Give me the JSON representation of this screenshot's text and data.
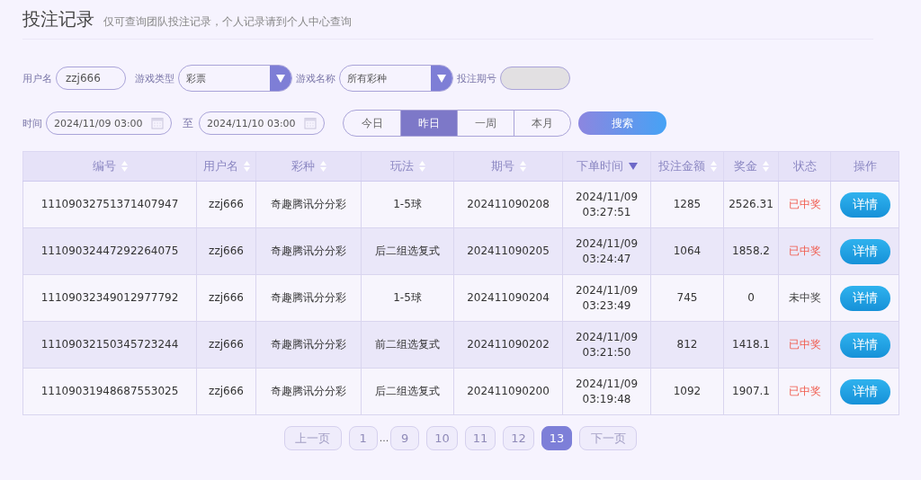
{
  "header": {
    "title": "投注记录",
    "subtitle": "仅可查询团队投注记录，个人记录请到个人中心查询"
  },
  "filters": {
    "username_label": "用户名",
    "username": "zzj666",
    "game_type_label": "游戏类型",
    "game_type": "彩票",
    "game_name_label": "游戏名称",
    "game_name": "所有彩种",
    "issue_label": "投注期号",
    "time_label": "时间",
    "time_from": "2024/11/09 03:00",
    "to_label": "至",
    "time_to": "2024/11/10 03:00",
    "ranges": [
      {
        "label": "今日",
        "selected": false
      },
      {
        "label": "昨日",
        "selected": true
      },
      {
        "label": "一周",
        "selected": false
      },
      {
        "label": "本月",
        "selected": false
      }
    ],
    "search_button": "搜索"
  },
  "table": {
    "columns": [
      {
        "label": "编号",
        "sortable": true,
        "sorted_desc": false
      },
      {
        "label": "用户名",
        "sortable": true,
        "sorted_desc": false
      },
      {
        "label": "彩种",
        "sortable": true,
        "sorted_desc": false
      },
      {
        "label": "玩法",
        "sortable": true,
        "sorted_desc": false
      },
      {
        "label": "期号",
        "sortable": true,
        "sorted_desc": false
      },
      {
        "label": "下单时间",
        "sortable": true,
        "sorted_desc": true
      },
      {
        "label": "投注金额",
        "sortable": true,
        "sorted_desc": false
      },
      {
        "label": "奖金",
        "sortable": true,
        "sorted_desc": false
      },
      {
        "label": "状态",
        "sortable": false
      },
      {
        "label": "操作",
        "sortable": false
      }
    ],
    "rows": [
      {
        "id": "11109032751371407947",
        "user": "zzj666",
        "lottery": "奇趣腾讯分分彩",
        "play": "1-5球",
        "issue": "202411090208",
        "date": "2024/11/09",
        "time": "03:27:51",
        "amount": "1285",
        "prize": "2526.31",
        "status": "已中奖",
        "won": true,
        "action": "详情"
      },
      {
        "id": "11109032447292264075",
        "user": "zzj666",
        "lottery": "奇趣腾讯分分彩",
        "play": "后二组选复式",
        "issue": "202411090205",
        "date": "2024/11/09",
        "time": "03:24:47",
        "amount": "1064",
        "prize": "1858.2",
        "status": "已中奖",
        "won": true,
        "action": "详情"
      },
      {
        "id": "11109032349012977792",
        "user": "zzj666",
        "lottery": "奇趣腾讯分分彩",
        "play": "1-5球",
        "issue": "202411090204",
        "date": "2024/11/09",
        "time": "03:23:49",
        "amount": "745",
        "prize": "0",
        "status": "未中奖",
        "won": false,
        "action": "详情"
      },
      {
        "id": "11109032150345723244",
        "user": "zzj666",
        "lottery": "奇趣腾讯分分彩",
        "play": "前二组选复式",
        "issue": "202411090202",
        "date": "2024/11/09",
        "time": "03:21:50",
        "amount": "812",
        "prize": "1418.1",
        "status": "已中奖",
        "won": true,
        "action": "详情"
      },
      {
        "id": "11109031948687553025",
        "user": "zzj666",
        "lottery": "奇趣腾讯分分彩",
        "play": "后二组选复式",
        "issue": "202411090200",
        "date": "2024/11/09",
        "time": "03:19:48",
        "amount": "1092",
        "prize": "1907.1",
        "status": "已中奖",
        "won": true,
        "action": "详情"
      }
    ]
  },
  "pagination": {
    "prev": "上一页",
    "next": "下一页",
    "prev_disabled": true,
    "next_disabled": true,
    "items": [
      {
        "kind": "page",
        "label": "1",
        "selected": false
      },
      {
        "kind": "ellipsis",
        "label": "..."
      },
      {
        "kind": "page",
        "label": "9",
        "selected": false
      },
      {
        "kind": "page",
        "label": "10",
        "selected": false
      },
      {
        "kind": "page",
        "label": "11",
        "selected": false
      },
      {
        "kind": "page",
        "label": "12",
        "selected": false
      },
      {
        "kind": "page",
        "label": "13",
        "selected": true
      }
    ]
  }
}
